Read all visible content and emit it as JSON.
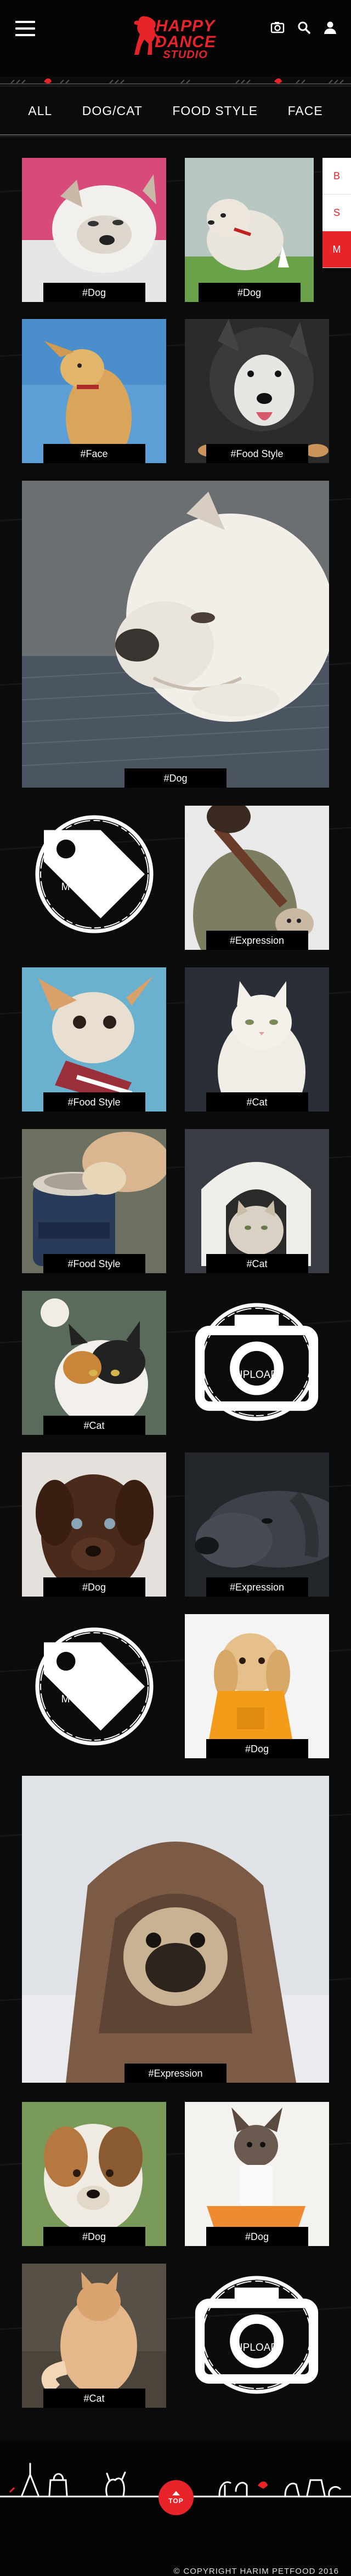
{
  "header": {
    "logo_line1": "HAPPY",
    "logo_line2": "DANCE",
    "logo_line3": "STUDIO",
    "icons": [
      "menu-icon",
      "camera-icon",
      "search-icon",
      "user-icon"
    ]
  },
  "nav": {
    "items": [
      "ALL",
      "DOG/CAT",
      "FOOD STYLE",
      "FACE"
    ]
  },
  "side_tabs": [
    "B",
    "S",
    "M"
  ],
  "side_tabs_active": "M",
  "gallery": {
    "tags": {
      "t1": "#Dog",
      "t2": "#Dog",
      "t3": "#Face",
      "t4": "#Food Style",
      "t5": "#Dog",
      "t6": "#Expression",
      "t7": "#Food Style",
      "t8": "#Cat",
      "t9": "#Food Style",
      "t10": "#Cat",
      "t11": "#Cat",
      "t12": "#Dog",
      "t13": "#Expression",
      "t14": "#Dog",
      "t15": "#Expression",
      "t16": "#Dog",
      "t17": "#Dog",
      "t18": "#Cat"
    },
    "my_gallery_label": "MY GALLERY",
    "upload_label": "UPLOAD"
  },
  "footer": {
    "top_label": "TOP",
    "copyright": "COPYRIGHT HARIM PETFOOD 2016"
  },
  "colors": {
    "accent": "#e8232a",
    "background": "#0b0b0b"
  }
}
